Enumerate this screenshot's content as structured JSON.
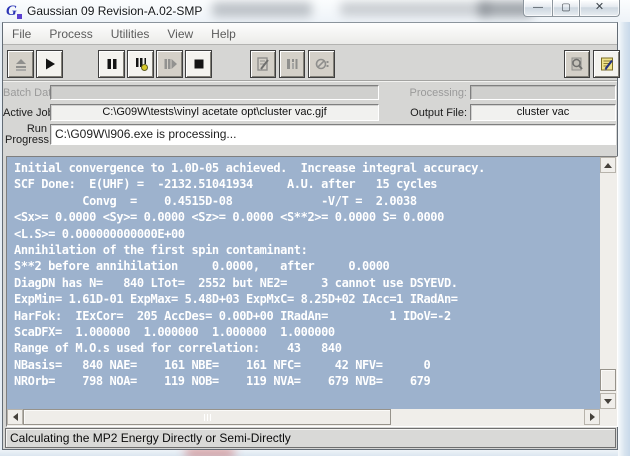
{
  "window": {
    "title": "Gaussian 09 Revision-A.02-SMP",
    "controls": {
      "minimize_glyph": "—",
      "maximize_glyph": "▢",
      "close_glyph": "✕"
    }
  },
  "menu": {
    "items": [
      "File",
      "Process",
      "Utilities",
      "View",
      "Help"
    ]
  },
  "toolbar": {
    "icons": [
      "eject-load-icon",
      "play-icon",
      "pause-icon",
      "pause-next-link-icon",
      "resume-icon",
      "stop-icon",
      "edit-document-icon",
      "batch-list-icon",
      "abort-icon",
      "magnifier-document-icon",
      "notepad-pencil-icon"
    ]
  },
  "fields": {
    "batch_data_label": "Batch Data:",
    "batch_data_value": "",
    "processing_label": "Processing:",
    "processing_value": "",
    "active_job_label": "Active Job:",
    "active_job_value": "C:\\G09W\\tests\\vinyl acetate opt\\cluster vac.gjf",
    "output_file_label": "Output File:",
    "output_file_value": "cluster vac",
    "run_progress_label": "Run\nProgress:",
    "run_progress_value": "C:\\G09W\\l906.exe is processing..."
  },
  "output": {
    "lines": [
      "Initial convergence to 1.0D-05 achieved.  Increase integral accuracy.",
      "SCF Done:  E(UHF) =  -2132.51041934     A.U. after   15 cycles",
      "          Convg  =    0.4515D-08             -V/T =  2.0038",
      "<Sx>= 0.0000 <Sy>= 0.0000 <Sz>= 0.0000 <S**2>= 0.0000 S= 0.0000",
      "<L.S>= 0.000000000000E+00",
      "Annihilation of the first spin contaminant:",
      "S**2 before annihilation     0.0000,   after     0.0000",
      "DiagDN has N=   840 LTot=  2552 but NE2=     3 cannot use DSYEVD.",
      "ExpMin= 1.61D-01 ExpMax= 5.48D+03 ExpMxC= 8.25D+02 IAcc=1 IRadAn=",
      "HarFok:  IExCor=  205 AccDes= 0.00D+00 IRadAn=         1 IDoV=-2",
      "ScaDFX=  1.000000  1.000000  1.000000  1.000000",
      "Range of M.O.s used for correlation:    43   840",
      "NBasis=   840 NAE=    161 NBE=    161 NFC=     42 NFV=      0",
      "NROrb=    798 NOA=    119 NOB=    119 NVA=    679 NVB=    679"
    ]
  },
  "status_bar": {
    "text": "Calculating the MP2 Energy Directly or Semi-Directly"
  },
  "colors": {
    "output_bg": "#9db2cd",
    "output_text": "#ffffff",
    "window_bg": "#d6d6d4",
    "disabled_field_bg": "#d0d0ce",
    "notepad_icon_yellow": "#efe38a"
  }
}
